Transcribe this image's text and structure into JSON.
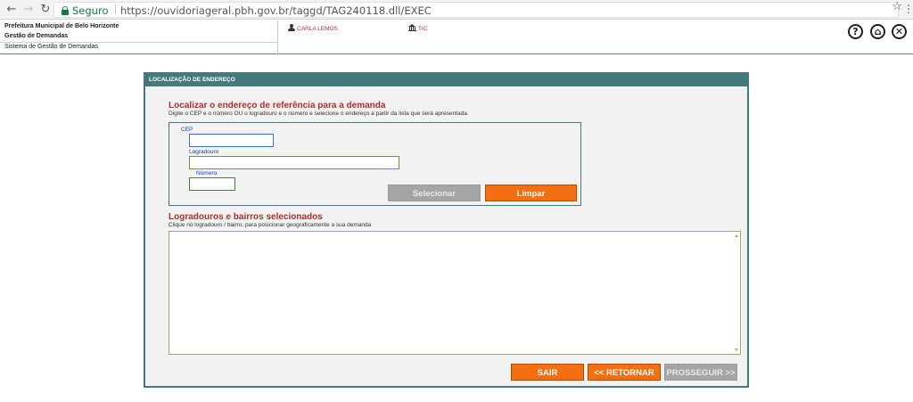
{
  "browser": {
    "secure_label": "Seguro",
    "url": "https://ouvidoriageral.pbh.gov.br/taggd/TAG240118.dll/EXEC",
    "icons": [
      "back-arrow-icon",
      "forward-arrow-icon",
      "reload-icon",
      "lock-icon",
      "star-icon",
      "menu-dots-icon"
    ]
  },
  "header": {
    "org_line1": "Prefeitura Municipal de Belo Horizonte",
    "org_line2": "Gestão de Demandas",
    "org_line3": "Sistema de Gestão de Demandas",
    "user_name": "CARLA LEMOS",
    "institution": "TIC",
    "help_label": "?",
    "home_label": "⌂",
    "close_label": "✕"
  },
  "panel": {
    "title": "LOCALIZAÇÃO DE ENDEREÇO",
    "locate_heading": "Localizar o endereço de referência para a demanda",
    "locate_hint": "Digite o CEP e o número OU o logradouro e o número e selecione o endereço a partir da lista que será apresentada.",
    "cep_label": "CEP",
    "cep_value": "",
    "logradouro_label": "Logradouro",
    "logradouro_value": "",
    "numero_label": "Número",
    "numero_value": "",
    "selecionar_label": "Selecionar",
    "limpar_label": "Limpar",
    "results_heading": "Logradouros e bairros selecionados",
    "results_hint": "Clique no logradouro / bairro, para posicionar geograficamente a sua demanda",
    "sair_label": "SAIR",
    "retornar_label": "<< RETORNAR",
    "prosseguir_label": "PROSSEGUIR >>"
  },
  "colors": {
    "accent_teal": "#447a7d",
    "heading_red": "#b2302b",
    "button_orange": "#f46e12",
    "button_disabled": "#a5a5a5"
  }
}
